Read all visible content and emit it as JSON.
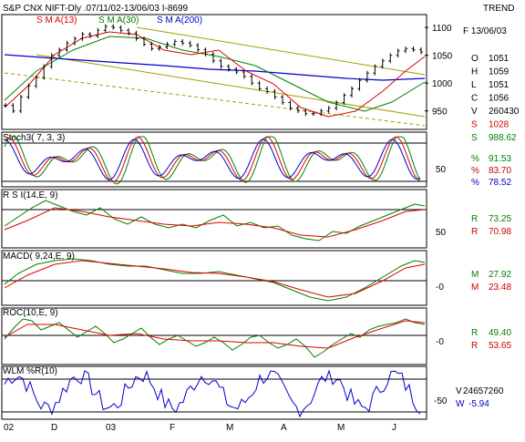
{
  "header": {
    "title": "S&P CNX NIFT-Dly .07/11/02-13/06/03 I-8699",
    "mode": "TREND",
    "legend": [
      {
        "label": "S M A(13)",
        "color": "#e00000"
      },
      {
        "label": "S M A(30)",
        "color": "#008000"
      },
      {
        "label": "S M A(200)",
        "color": "#0000cc"
      }
    ]
  },
  "colors": {
    "price": "#000000",
    "sma13": "#e00000",
    "sma30": "#008000",
    "sma200": "#0000cc",
    "channel": "#a0a000",
    "pct_k": "#008000",
    "pct_d": "#e00000",
    "pct_slow": "#0000cc",
    "axis": "#000000",
    "value_green": "#008000",
    "value_red": "#cc0000",
    "value_blue": "#0000cc"
  },
  "ohlc_panel": {
    "date_label": "F 13/06/03",
    "rows": [
      {
        "key": "O",
        "value": "1051",
        "color": "#000000"
      },
      {
        "key": "H",
        "value": "1059",
        "color": "#000000"
      },
      {
        "key": "L",
        "value": "1051",
        "color": "#000000"
      },
      {
        "key": "C",
        "value": "1056",
        "color": "#000000"
      },
      {
        "key": "V",
        "value": "260430",
        "color": "#000000"
      },
      {
        "key": "S",
        "value": "1028",
        "color": "#cc0000"
      },
      {
        "key": "S",
        "value": "988.62",
        "color": "#008000"
      }
    ]
  },
  "panels": {
    "stoch": {
      "title": "Stoch3( 7, 3, 3)",
      "ticks": [
        "50"
      ],
      "values": [
        {
          "key": "%",
          "value": "91.53",
          "color": "#008000"
        },
        {
          "key": "%",
          "value": "83.70",
          "color": "#cc0000"
        },
        {
          "key": "%",
          "value": "78.52",
          "color": "#0000cc"
        }
      ]
    },
    "rsi": {
      "title": "R S I(14,E, 9)",
      "ticks": [
        "50"
      ],
      "values": [
        {
          "key": "R",
          "value": "73.25",
          "color": "#008000"
        },
        {
          "key": "R",
          "value": "70.98",
          "color": "#cc0000"
        }
      ]
    },
    "macd": {
      "title": "MACD( 9,24,E, 9)",
      "ticks": [
        "-0"
      ],
      "values": [
        {
          "key": "M",
          "value": "27.92",
          "color": "#008000"
        },
        {
          "key": "M",
          "value": "23.48",
          "color": "#cc0000"
        }
      ]
    },
    "roc": {
      "title": "ROC(10,E, 9)",
      "ticks": [
        "-0"
      ],
      "values": [
        {
          "key": "R",
          "value": "49.40",
          "color": "#008000"
        },
        {
          "key": "R",
          "value": "53.65",
          "color": "#cc0000"
        }
      ]
    },
    "wlm": {
      "title": "WLM %R(10)",
      "ticks": [
        "-50"
      ],
      "values": [
        {
          "key": "V",
          "value": "24657260",
          "color": "#000000"
        },
        {
          "key": "W",
          "value": "-5.94",
          "color": "#0000cc"
        }
      ]
    }
  },
  "x_axis": {
    "labels": [
      "02",
      "D",
      "03",
      "F",
      "M",
      "A",
      "M",
      "J"
    ]
  },
  "chart_data": {
    "type": "line",
    "series_price_close": [
      960,
      950,
      975,
      995,
      1010,
      1030,
      1050,
      1060,
      1072,
      1080,
      1088,
      1085,
      1095,
      1102,
      1100,
      1095,
      1090,
      1080,
      1070,
      1062,
      1065,
      1070,
      1075,
      1072,
      1068,
      1060,
      1052,
      1040,
      1030,
      1025,
      1020,
      1012,
      1000,
      990,
      985,
      975,
      965,
      955,
      950,
      945,
      945,
      950,
      955,
      965,
      978,
      990,
      1005,
      1018,
      1030,
      1040,
      1050,
      1058,
      1062,
      1060,
      1056
    ],
    "price_ylim": [
      920,
      1120
    ],
    "price_ticks": [
      1100,
      1050,
      1000,
      950
    ],
    "stoch_ylim": [
      0,
      100
    ],
    "rsi_ylim": [
      20,
      80
    ],
    "wlm_ylim": [
      -100,
      0
    ]
  }
}
